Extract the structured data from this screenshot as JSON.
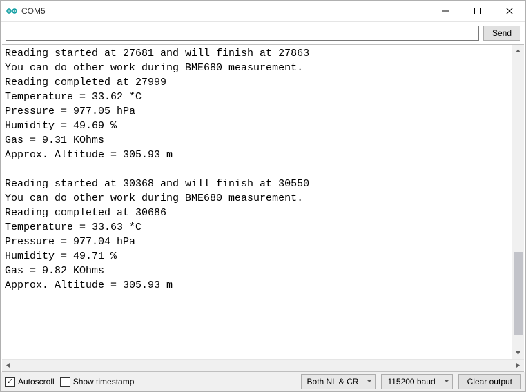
{
  "window": {
    "title": "COM5"
  },
  "toolbar": {
    "input_value": "",
    "send_label": "Send"
  },
  "output_lines": [
    "Reading started at 27681 and will finish at 27863",
    "You can do other work during BME680 measurement.",
    "Reading completed at 27999",
    "Temperature = 33.62 *C",
    "Pressure = 977.05 hPa",
    "Humidity = 49.69 %",
    "Gas = 9.31 KOhms",
    "Approx. Altitude = 305.93 m",
    "",
    "Reading started at 30368 and will finish at 30550",
    "You can do other work during BME680 measurement.",
    "Reading completed at 30686",
    "Temperature = 33.63 *C",
    "Pressure = 977.04 hPa",
    "Humidity = 49.71 %",
    "Gas = 9.82 KOhms",
    "Approx. Altitude = 305.93 m"
  ],
  "status": {
    "autoscroll_label": "Autoscroll",
    "autoscroll_checked": true,
    "timestamp_label": "Show timestamp",
    "timestamp_checked": false,
    "line_ending_selected": "Both NL & CR",
    "baud_selected": "115200 baud",
    "clear_label": "Clear output"
  }
}
